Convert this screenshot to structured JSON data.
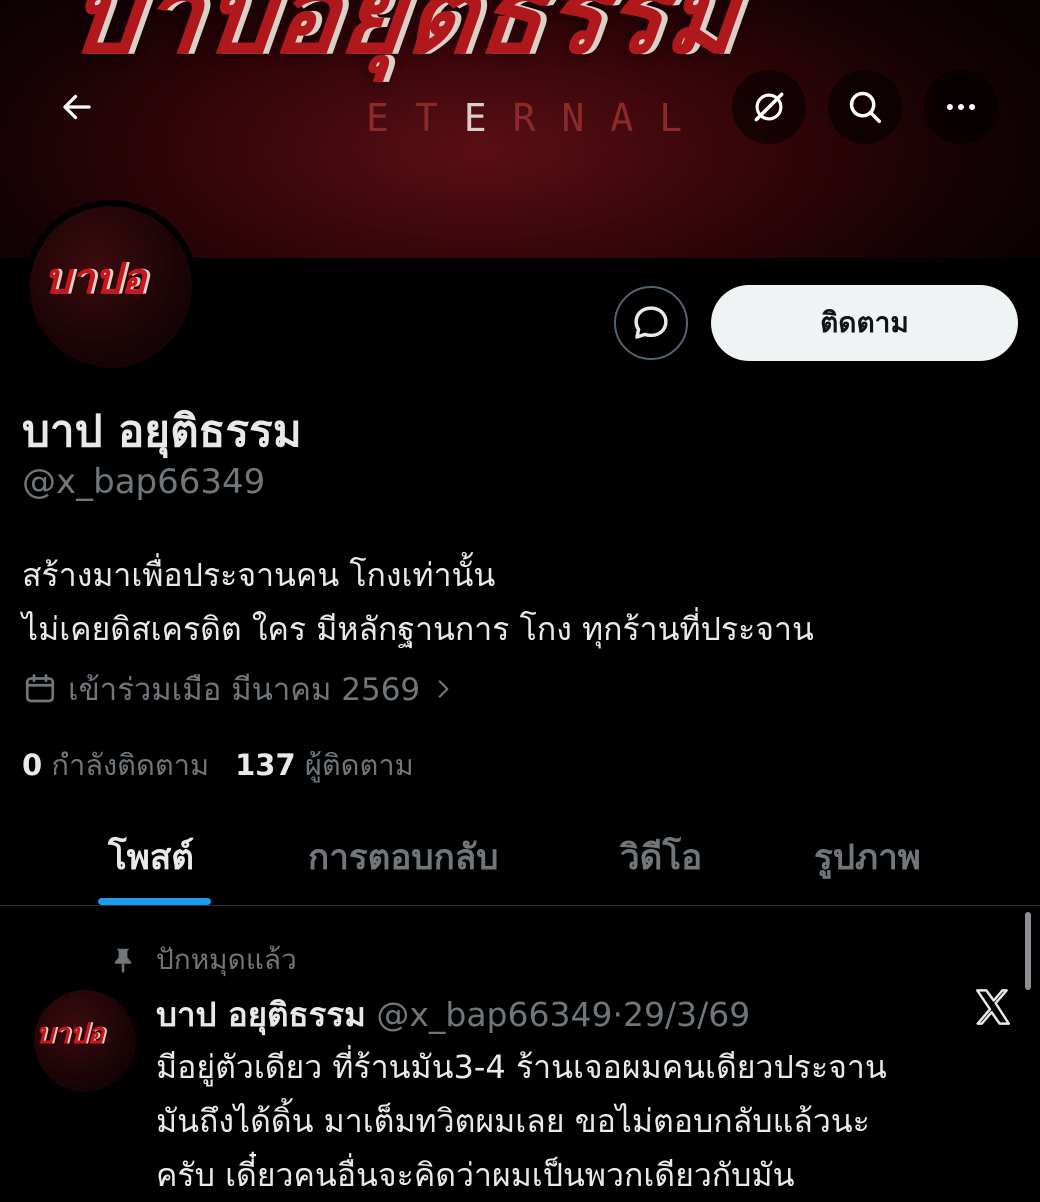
{
  "banner": {
    "title": "บาปอยุติธรรม",
    "subtitle_a": "ET",
    "subtitle_b": "E",
    "subtitle_c": "RNAL"
  },
  "avatar": {
    "text": "บาปอ"
  },
  "actions": {
    "follow_label": "ติดตาม"
  },
  "profile": {
    "display_name": "บาป อยุติธรรม",
    "handle": "@x_bap66349",
    "bio": [
      "สร้างมาเพื่อประจานคน โกงเท่านั้น",
      "ไม่เคยดิสเครดิต ใคร มีหลักฐานการ โกง ทุกร้านที่ประจาน"
    ],
    "joined": "เข้าร่วมเมือ มีนาคม 2569",
    "following_count": "0",
    "following_label": "กำลังติดตาม",
    "followers_count": "137",
    "followers_label": "ผู้ติดตาม"
  },
  "tabs": [
    "โพสต์",
    "การตอบกลับ",
    "วิดีโอ",
    "รูปภาพ"
  ],
  "post": {
    "pinned_label": "ปักหมุดแล้ว",
    "author_name": "บาป อยุติธรรม",
    "author_handle": "@x_bap66349",
    "separator": "·",
    "date": "29/3/69",
    "lines": [
      "มีอยู่ตัวเดียว ที่ร้านมัน3-4 ร้านเจอผมคนเดียวประจาน",
      "มันถึงได้ดิ้น  มาเต็มทวิตผมเลย ขอไม่ตอบกลับแล้วนะ",
      "ครับ เดี๋ยวคนอื่นจะคิดว่าผมเป็นพวกเดียวกับมัน"
    ]
  },
  "colors": {
    "accent": "#1d9bf0",
    "background": "#000000",
    "text_primary": "#e7e9ea",
    "text_secondary": "#71767b",
    "follow_button_bg": "#eff3f4"
  },
  "icons": [
    "back-arrow-icon",
    "grok-icon",
    "search-icon",
    "more-icon",
    "message-icon",
    "calendar-icon",
    "chevron-right-icon",
    "pin-icon",
    "x-logo-icon"
  ]
}
